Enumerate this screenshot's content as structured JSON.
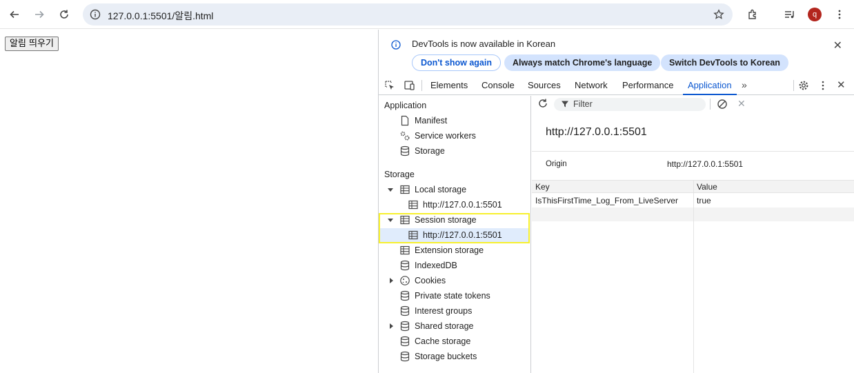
{
  "browser": {
    "url": "127.0.0.1:5501/알림.html",
    "profile_initial": "q",
    "icons": [
      "back-icon",
      "forward-icon",
      "reload-icon",
      "site-info-icon",
      "bookmark-star-icon",
      "extensions-icon",
      "media-queue-icon",
      "more-vert-icon"
    ]
  },
  "page": {
    "button_label": "알림 띄우기"
  },
  "devtools": {
    "infobar": {
      "message": "DevTools is now available in Korean",
      "dont_show": "Don't show again",
      "match_lang": "Always match Chrome's language",
      "switch_lang": "Switch DevTools to Korean"
    },
    "tabs": [
      "Elements",
      "Console",
      "Sources",
      "Network",
      "Performance",
      "Application"
    ],
    "active_tab": "Application",
    "sidebar": {
      "application_header": "Application",
      "application_items": [
        "Manifest",
        "Service workers",
        "Storage"
      ],
      "storage_header": "Storage",
      "local_storage": "Local storage",
      "local_origin": "http://127.0.0.1:5501",
      "session_storage": "Session storage",
      "session_origin": "http://127.0.0.1:5501",
      "other_items": [
        "Extension storage",
        "IndexedDB",
        "Cookies",
        "Private state tokens",
        "Interest groups",
        "Shared storage",
        "Cache storage",
        "Storage buckets"
      ]
    },
    "main": {
      "filter_placeholder": "Filter",
      "title": "http://127.0.0.1:5501",
      "origin_label": "Origin",
      "origin_value": "http://127.0.0.1:5501",
      "columns": [
        "Key",
        "Value"
      ],
      "rows": [
        {
          "key": "IsThisFirstTime_Log_From_LiveServer",
          "value": "true"
        }
      ]
    },
    "colors": {
      "accent": "#0b57d0",
      "highlight": "#f7f02c",
      "selected_row": "#e0ecfc"
    }
  }
}
